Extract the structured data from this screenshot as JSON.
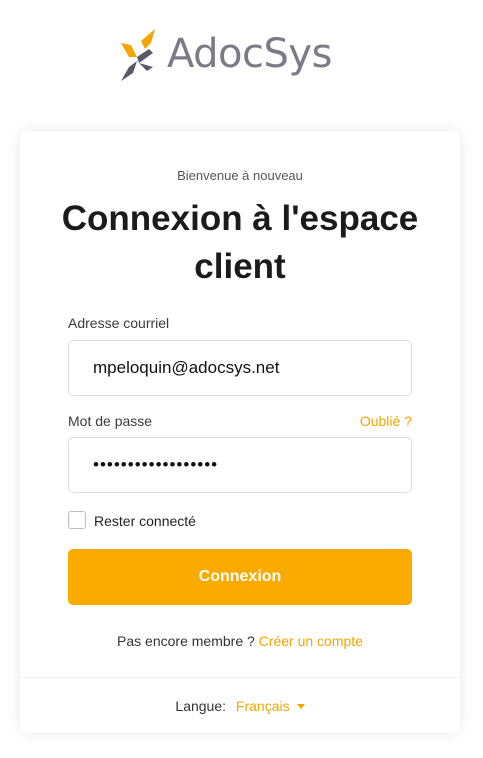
{
  "brand": {
    "name": "AdocSys",
    "logo_icon": "adocsys-logo-mark",
    "colors": {
      "accent": "#fbab00",
      "link": "#f6a500",
      "logo_text": "#7b7a86",
      "logo_dark": "#5a5968"
    }
  },
  "card": {
    "welcome": "Bienvenue à nouveau",
    "title": "Connexion à l'espace client",
    "email": {
      "label": "Adresse courriel",
      "value": "mpeloquin@adocsys.net"
    },
    "password": {
      "label": "Mot de passe",
      "value": "••••••••••••••••••",
      "forgot_link": "Oublié ?"
    },
    "remember": {
      "label": "Rester connecté",
      "checked": false
    },
    "submit_label": "Connexion",
    "signup": {
      "prompt": "Pas encore membre ?",
      "link": "Créer un compte"
    },
    "language": {
      "label": "Langue:",
      "selected": "Français"
    }
  }
}
